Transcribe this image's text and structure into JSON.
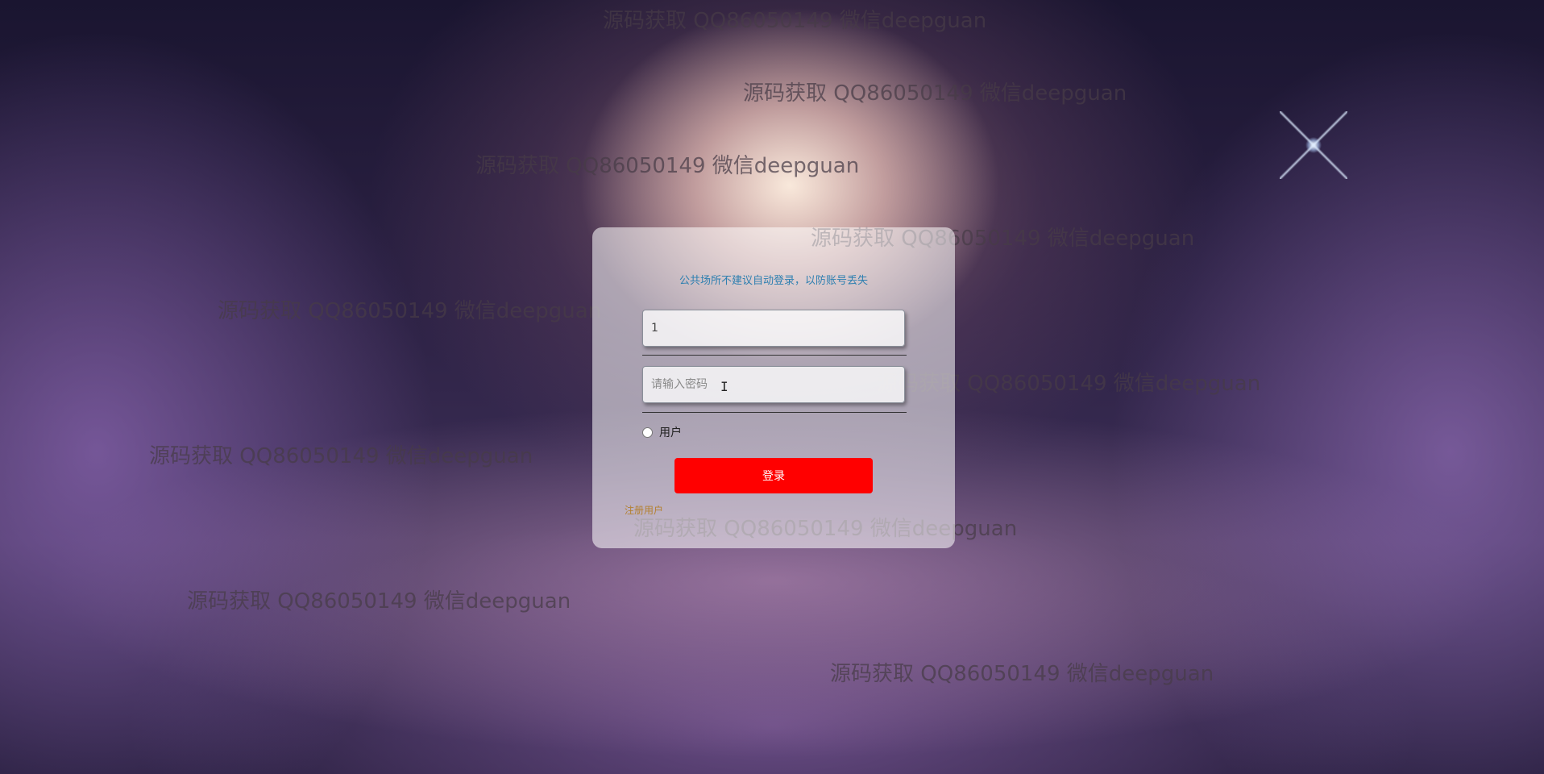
{
  "watermark": "源码获取 QQ86050149 微信deepguan",
  "login": {
    "hint": "公共场所不建议自动登录，以防账号丢失",
    "username_value": "1",
    "password_placeholder": "请输入密码",
    "role_label": "用户",
    "role_selected": false,
    "submit_label": "登录",
    "register_link": "注册用户"
  },
  "colors": {
    "button": "#ff0000",
    "hint_text": "#2d7fb0",
    "register_text": "#b3802f"
  }
}
